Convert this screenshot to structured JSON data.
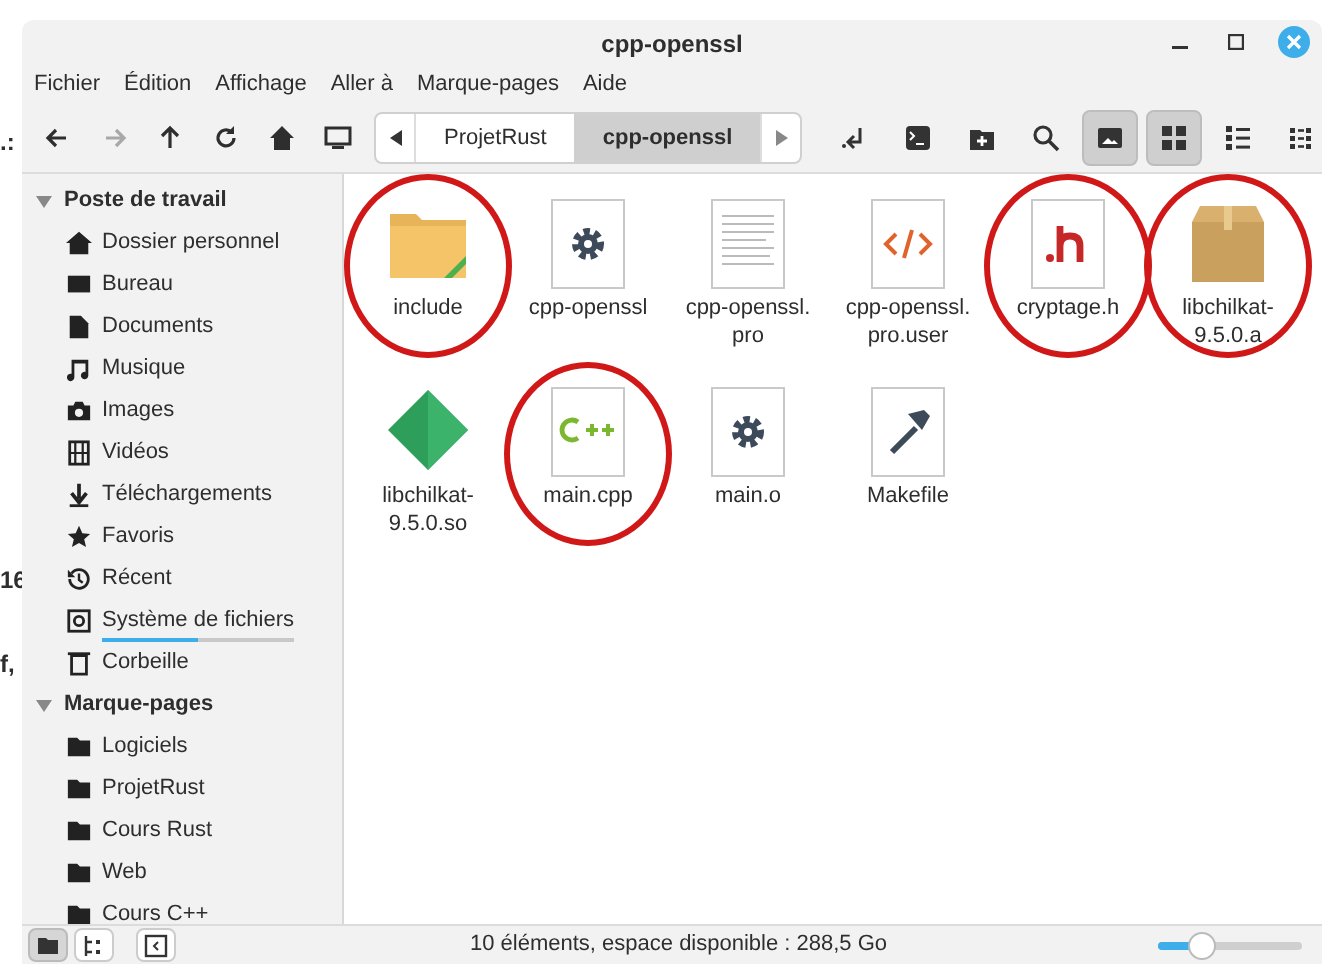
{
  "background_fragments": [
    ".:",
    "16",
    "f,"
  ],
  "window": {
    "title": "cpp-openssl"
  },
  "menu": [
    "Fichier",
    "Édition",
    "Affichage",
    "Aller à",
    "Marque-pages",
    "Aide"
  ],
  "toolbar": {
    "nav": [
      {
        "kind": "back",
        "disabled": false
      },
      {
        "kind": "forward",
        "disabled": true
      },
      {
        "kind": "up",
        "disabled": false
      },
      {
        "kind": "reload",
        "disabled": false
      },
      {
        "kind": "home",
        "disabled": false
      },
      {
        "kind": "computer",
        "disabled": false
      }
    ],
    "path": [
      {
        "label": "ProjetRust",
        "selected": false
      },
      {
        "label": "cpp-openssl",
        "selected": true
      }
    ],
    "tools": [
      {
        "kind": "toggle-location",
        "selected": false
      },
      {
        "kind": "terminal",
        "selected": false
      },
      {
        "kind": "new-folder",
        "selected": false
      },
      {
        "kind": "search",
        "selected": false
      },
      {
        "kind": "thumbnails",
        "selected": true
      },
      {
        "kind": "icon-view",
        "selected": true
      },
      {
        "kind": "list-view",
        "selected": false
      },
      {
        "kind": "compact-view",
        "selected": false
      }
    ]
  },
  "sidebar": [
    {
      "label": "Poste de travail",
      "expanded": true,
      "children": [
        {
          "label": "Dossier personnel",
          "kind": "home"
        },
        {
          "label": "Bureau",
          "kind": "desktop"
        },
        {
          "label": "Documents",
          "kind": "document"
        },
        {
          "label": "Musique",
          "kind": "music"
        },
        {
          "label": "Images",
          "kind": "camera"
        },
        {
          "label": "Vidéos",
          "kind": "film"
        },
        {
          "label": "Téléchargements",
          "kind": "download"
        },
        {
          "label": "Favoris",
          "kind": "star"
        },
        {
          "label": "Récent",
          "kind": "history"
        },
        {
          "label": "Système de fichiers",
          "kind": "drive",
          "level": 0.5
        },
        {
          "label": "Corbeille",
          "kind": "trash"
        }
      ]
    },
    {
      "label": "Marque-pages",
      "expanded": true,
      "children": [
        {
          "label": "Logiciels",
          "kind": "folder"
        },
        {
          "label": "ProjetRust",
          "kind": "folder"
        },
        {
          "label": "Cours Rust",
          "kind": "folder"
        },
        {
          "label": "Web",
          "kind": "folder"
        },
        {
          "label": "Cours C++",
          "kind": "folder"
        }
      ]
    }
  ],
  "files": [
    {
      "name": "include",
      "kind": "folder",
      "circled": true
    },
    {
      "name": "cpp-openssl",
      "kind": "executable",
      "circled": false
    },
    {
      "name": "cpp-openssl.\npro",
      "kind": "text",
      "circled": false
    },
    {
      "name": "cpp-openssl.\npro.user",
      "kind": "markup",
      "circled": false
    },
    {
      "name": "cryptage.h",
      "kind": "header",
      "circled": true
    },
    {
      "name": "libchilkat-\n9.5.0.a",
      "kind": "archive",
      "circled": true
    },
    {
      "name": "libchilkat-\n9.5.0.so",
      "kind": "library",
      "circled": false
    },
    {
      "name": "main.cpp",
      "kind": "cpp",
      "circled": true
    },
    {
      "name": "main.o",
      "kind": "executable",
      "circled": false
    },
    {
      "name": "Makefile",
      "kind": "makefile",
      "circled": false
    }
  ],
  "status_bar": {
    "panes": [
      {
        "kind": "places",
        "selected": true
      },
      {
        "kind": "tree",
        "selected": false
      },
      {
        "kind": "toggle-sidebar",
        "selected": false
      }
    ],
    "text": "10 éléments, espace disponible : 288,5 Go",
    "zoom": {
      "level": 0.3
    }
  }
}
